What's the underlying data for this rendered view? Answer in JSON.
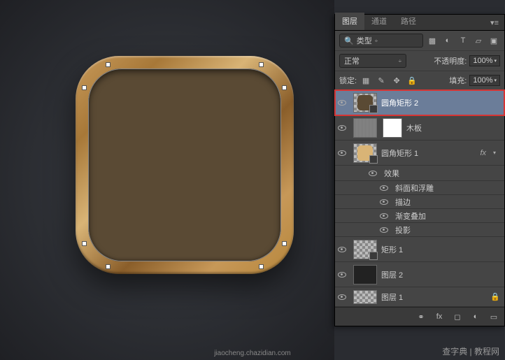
{
  "tabs": {
    "layers": "图层",
    "channels": "通道",
    "paths": "路径"
  },
  "filter": {
    "label": "类型"
  },
  "blend": {
    "mode": "正常",
    "opacity_label": "不透明度:",
    "opacity": "100%"
  },
  "lock": {
    "label": "锁定:",
    "fill_label": "填充:",
    "fill": "100%"
  },
  "layers_list": [
    {
      "name": "圆角矩形 2"
    },
    {
      "name": "木板"
    },
    {
      "name": "圆角矩形 1"
    },
    {
      "fx_header": "效果"
    },
    {
      "fx": "斜面和浮雕"
    },
    {
      "fx": "描边"
    },
    {
      "fx": "渐变叠加"
    },
    {
      "fx": "投影"
    },
    {
      "name": "矩形 1"
    },
    {
      "name": "图层 2"
    },
    {
      "name": "图层 1"
    }
  ],
  "watermark": "查字典 | 教程网",
  "url": "jiaocheng.chazidian.com"
}
